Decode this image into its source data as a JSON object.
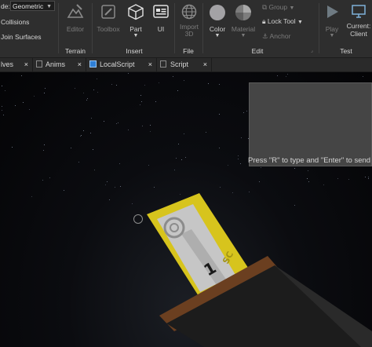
{
  "ribbon": {
    "mode_prefix": "de:",
    "mode_value": "Geometric",
    "collisions": "Collisions",
    "join_surfaces": "Join Surfaces",
    "editor": "Editor",
    "toolbox": "Toolbox",
    "part": "Part",
    "ui": "UI",
    "import_3d_line1": "Import",
    "import_3d_line2": "3D",
    "color": "Color",
    "material": "Material",
    "group": "Group",
    "lock_tool": "Lock Tool",
    "anchor": "Anchor",
    "play": "Play",
    "current_client_line1": "Current:",
    "current_client_line2": "Client",
    "groups": {
      "terrain": "Terrain",
      "insert": "Insert",
      "file": "File",
      "edit": "Edit",
      "test": "Test"
    }
  },
  "tabs": [
    {
      "label": "lves",
      "closable": true
    },
    {
      "label": "Anims",
      "closable": true
    },
    {
      "label": "LocalScript",
      "closable": true
    },
    {
      "label": "Script",
      "closable": true
    }
  ],
  "tab_close_glyph": "×",
  "viewport": {
    "chat_hint": "Press \"R\" to type and \"Enter\" to send"
  },
  "colors": {
    "ribbon_bg": "#2e2e2e",
    "card_yellow": "#d9c51c",
    "card_gray": "#c9c9c9",
    "hand_dark": "#1c1c1c",
    "cuff_brown": "#6b3f20",
    "chat_box": "#454545"
  }
}
